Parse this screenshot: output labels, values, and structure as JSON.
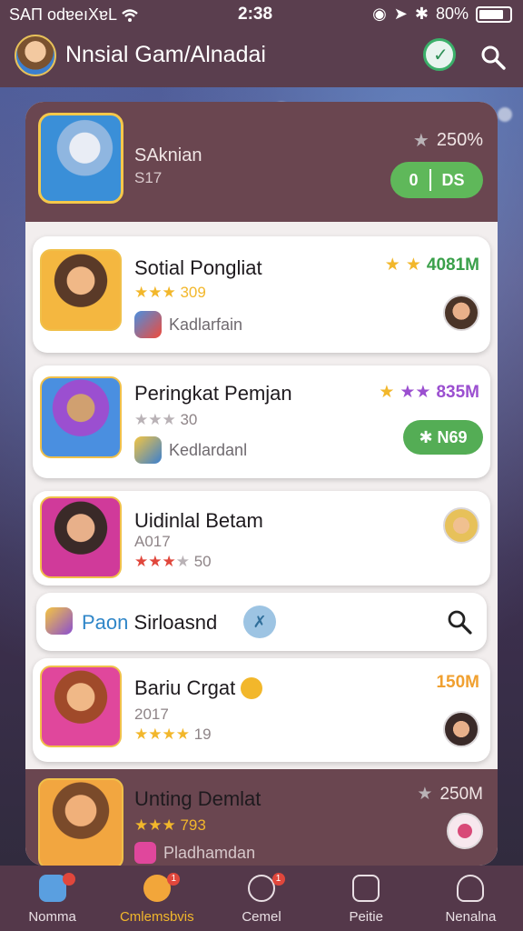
{
  "status": {
    "carrier": "SAП odɐeıXɐL",
    "time": "2:38",
    "battery_pct": "80%"
  },
  "header": {
    "title": "Nnsial Gam/Alnadai",
    "verified_icon": "check-badge-icon",
    "search_icon": "search-icon"
  },
  "featured": {
    "name": "SAknian",
    "sub": "S17",
    "rating": "250%",
    "button_left": "0",
    "button_right": "DS"
  },
  "cards": [
    {
      "name": "Sotial Pongliat",
      "rating_text": "309",
      "sublabel": "Kadlarfain",
      "score": "4081M",
      "score_color": "#3aa04a",
      "stars": [
        "full",
        "full"
      ]
    },
    {
      "name": "Peringkat Pemjan",
      "rating_text": "30",
      "sublabel": "Kedlardanl",
      "score": "835M",
      "score_color": "#9b4fd0",
      "pill": "✱ N69"
    },
    {
      "name": "Uidinlal Betam",
      "meta": "A017",
      "rating_text": "50"
    },
    {
      "name": "Bariu Crgat",
      "meta": "2017",
      "rating_text": "19",
      "score": "150M",
      "score_color": "#f0a030"
    }
  ],
  "search_row": {
    "prefix": "Paon",
    "label": "Sirloasnd",
    "chip": "✗"
  },
  "last_card": {
    "name": "Unting Demlat",
    "rating_text": "793",
    "sublabel": "Pladhamdan",
    "score": "250M"
  },
  "nav": [
    {
      "label": "Nomma",
      "icon": "home-icon",
      "active": false,
      "badge": ""
    },
    {
      "label": "Cmlemsbvis",
      "icon": "games-icon",
      "active": true,
      "badge": "1"
    },
    {
      "label": "Cemel",
      "icon": "chat-icon",
      "active": false,
      "badge": "1"
    },
    {
      "label": "Peitie",
      "icon": "camera-icon",
      "active": false,
      "badge": ""
    },
    {
      "label": "Nenalna",
      "icon": "profile-icon",
      "active": false,
      "badge": ""
    }
  ]
}
